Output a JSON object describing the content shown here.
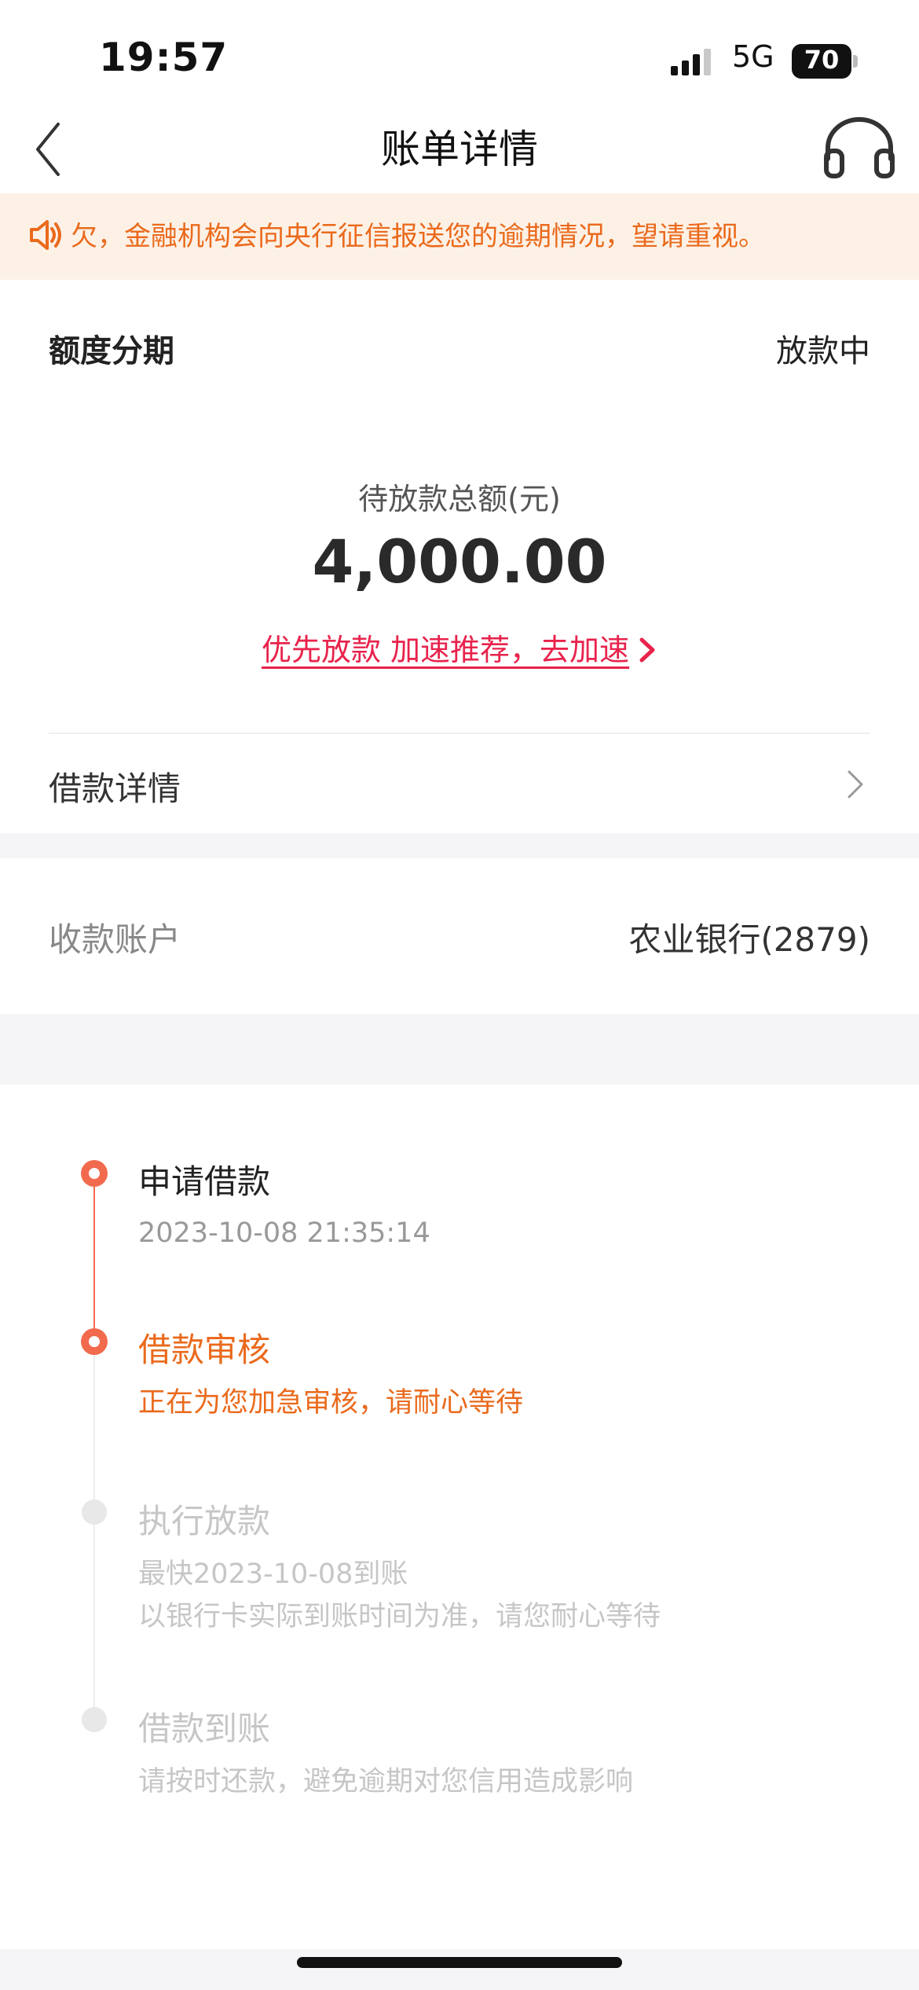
{
  "status_bar": {
    "time": "19:57",
    "network": "5G",
    "battery": "70"
  },
  "nav": {
    "title": "账单详情"
  },
  "notice": {
    "text": "欠，金融机构会向央行征信报送您的逾期情况，望请重视。"
  },
  "loan": {
    "product_name": "额度分期",
    "status": "放款中",
    "amount_label": "待放款总额(元)",
    "amount": "4,000.00",
    "accelerate_link": "优先放款 加速推荐，去加速",
    "detail_label": "借款详情"
  },
  "account": {
    "label": "收款账户",
    "value": "农业银行(2879)"
  },
  "timeline": {
    "steps": [
      {
        "title": "申请借款",
        "lines": [
          "2023-10-08 21:35:14"
        ]
      },
      {
        "title": "借款审核",
        "lines": [
          "正在为您加急审核，请耐心等待"
        ]
      },
      {
        "title": "执行放款",
        "lines": [
          "最快2023-10-08到账",
          "以银行卡实际到账时间为准，请您耐心等待"
        ]
      },
      {
        "title": "借款到账",
        "lines": [
          "请按时还款，避免逾期对您信用造成影响"
        ]
      }
    ]
  },
  "colors": {
    "accent_orange": "#ea6a1c",
    "timeline_active": "#f26a4e",
    "link_red": "#e8234c",
    "notice_bg": "#fdf1e6"
  },
  "icons": {
    "back": "chevron-left-icon",
    "service": "headset-icon",
    "notice": "speaker-icon",
    "link": "chevron-right-icon",
    "row": "chevron-right-icon"
  }
}
